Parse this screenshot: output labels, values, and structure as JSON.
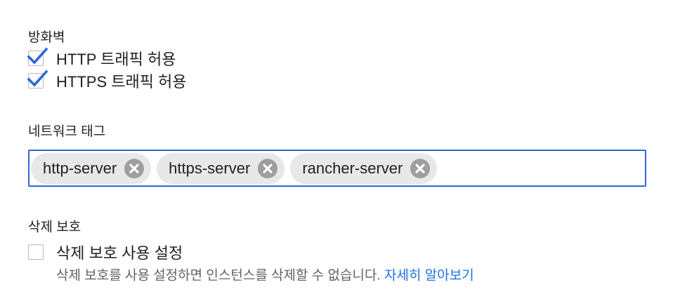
{
  "firewall": {
    "title": "방화벽",
    "options": [
      {
        "label": "HTTP 트래픽 허용",
        "checked": true
      },
      {
        "label": "HTTPS 트래픽 허용",
        "checked": true
      }
    ]
  },
  "network_tags": {
    "title": "네트워크 태그",
    "tags": [
      "http-server",
      "https-server",
      "rancher-server"
    ]
  },
  "deletion_protection": {
    "title": "삭제 보호",
    "checkbox_label": "삭제 보호 사용 설정",
    "checked": false,
    "help_text": "삭제 보호를 사용 설정하면 인스턴스를 삭제할 수 없습니다.",
    "learn_more": "자세히 알아보기"
  },
  "colors": {
    "accent": "#3367d6",
    "link": "#1a73e8",
    "check": "#3367d6",
    "chip_bg": "#e8e8e8",
    "chip_remove": "#9e9e9e"
  }
}
